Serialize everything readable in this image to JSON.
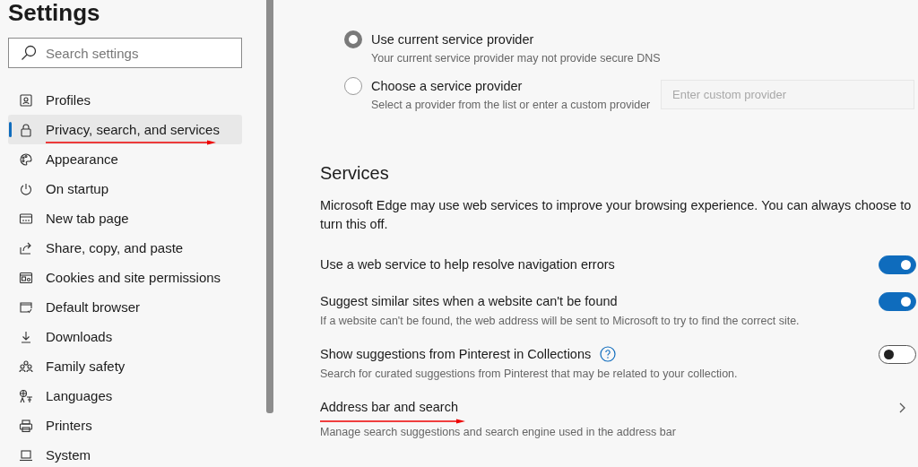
{
  "sidebar": {
    "title": "Settings",
    "search": {
      "placeholder": "Search settings"
    },
    "items": [
      {
        "label": "Profiles",
        "selected": false,
        "underlined": false
      },
      {
        "label": "Privacy, search, and services",
        "selected": true,
        "underlined": true
      },
      {
        "label": "Appearance",
        "selected": false,
        "underlined": false
      },
      {
        "label": "On startup",
        "selected": false,
        "underlined": false
      },
      {
        "label": "New tab page",
        "selected": false,
        "underlined": false
      },
      {
        "label": "Share, copy, and paste",
        "selected": false,
        "underlined": false
      },
      {
        "label": "Cookies and site permissions",
        "selected": false,
        "underlined": false
      },
      {
        "label": "Default browser",
        "selected": false,
        "underlined": false
      },
      {
        "label": "Downloads",
        "selected": false,
        "underlined": false
      },
      {
        "label": "Family safety",
        "selected": false,
        "underlined": false
      },
      {
        "label": "Languages",
        "selected": false,
        "underlined": false
      },
      {
        "label": "Printers",
        "selected": false,
        "underlined": false
      },
      {
        "label": "System",
        "selected": false,
        "underlined": false
      }
    ]
  },
  "dns_options": [
    {
      "label": "Use current service provider",
      "description": "Your current service provider may not provide secure DNS",
      "selected": true
    },
    {
      "label": "Choose a service provider",
      "description": "Select a provider from the list or enter a custom provider",
      "selected": false,
      "field": {
        "placeholder": "Enter custom provider",
        "disabled": true
      }
    }
  ],
  "services": {
    "heading": "Services",
    "description": "Microsoft Edge may use web services to improve your browsing experience. You can always choose to turn this off.",
    "rows": [
      {
        "kind": "toggle",
        "label": "Use a web service to help resolve navigation errors",
        "on": true,
        "underlined": false
      },
      {
        "kind": "toggle",
        "label": "Suggest similar sites when a website can't be found",
        "description": "If a website can't be found, the web address will be sent to Microsoft to try to find the correct site.",
        "on": true,
        "underlined": false
      },
      {
        "kind": "toggle",
        "label": "Show suggestions from Pinterest in Collections",
        "help": true,
        "description": "Search for curated suggestions from Pinterest that may be related to your collection.",
        "on": false,
        "underlined": false
      },
      {
        "kind": "link",
        "label": "Address bar and search",
        "description": "Manage search suggestions and search engine used in the address bar",
        "underlined": true
      }
    ]
  }
}
